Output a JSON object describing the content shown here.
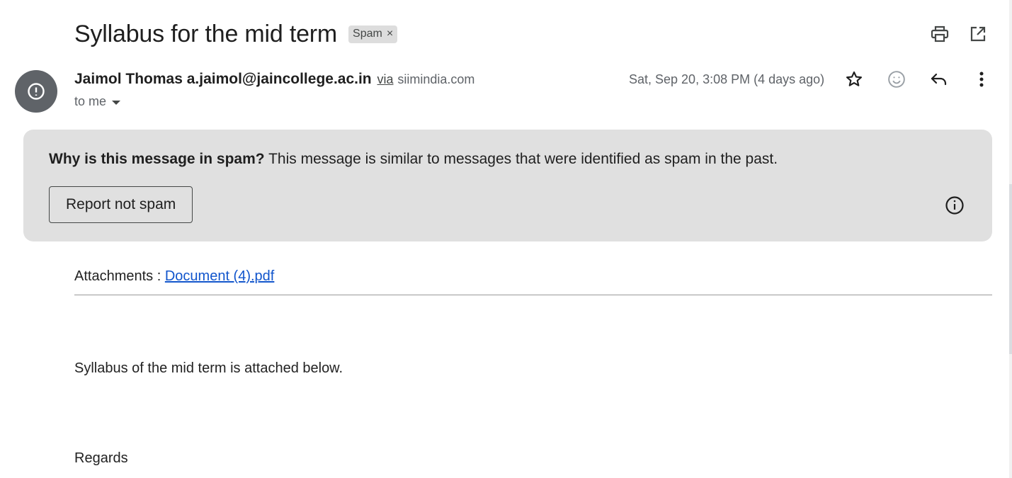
{
  "subject": "Syllabus for the mid term",
  "label": {
    "name": "Spam",
    "remove_glyph": "×"
  },
  "header_icons": [
    "print-icon",
    "open-in-new-window-icon"
  ],
  "sender": {
    "name": "Jaimol Thomas",
    "email": "a.jaimol@jaincollege.ac.in",
    "via_label": "via",
    "via_domain": "siimindia.com",
    "recipient": "to me",
    "avatar_icon": "alert-circle-icon",
    "avatar_color": "#5f6368"
  },
  "date": "Sat, Sep 20, 3:08 PM (4 days ago)",
  "message_actions": [
    "star-icon",
    "emoji-reaction-icon",
    "reply-icon",
    "more-vert-icon"
  ],
  "spam_banner": {
    "question": "Why is this message in spam?",
    "explanation": "This message is similar to messages that were identified as spam in the past.",
    "button_label": "Report not spam",
    "info_icon": "info-icon",
    "background": "#e0e0e0"
  },
  "body": {
    "attachments_label": "Attachments : ",
    "attachment_name": "Document (4).pdf",
    "line1": "Syllabus of the mid term is attached below.",
    "line2": "Regards"
  },
  "colors": {
    "link": "#1155cc",
    "text": "#1f1f1f",
    "muted": "#5f6368"
  }
}
